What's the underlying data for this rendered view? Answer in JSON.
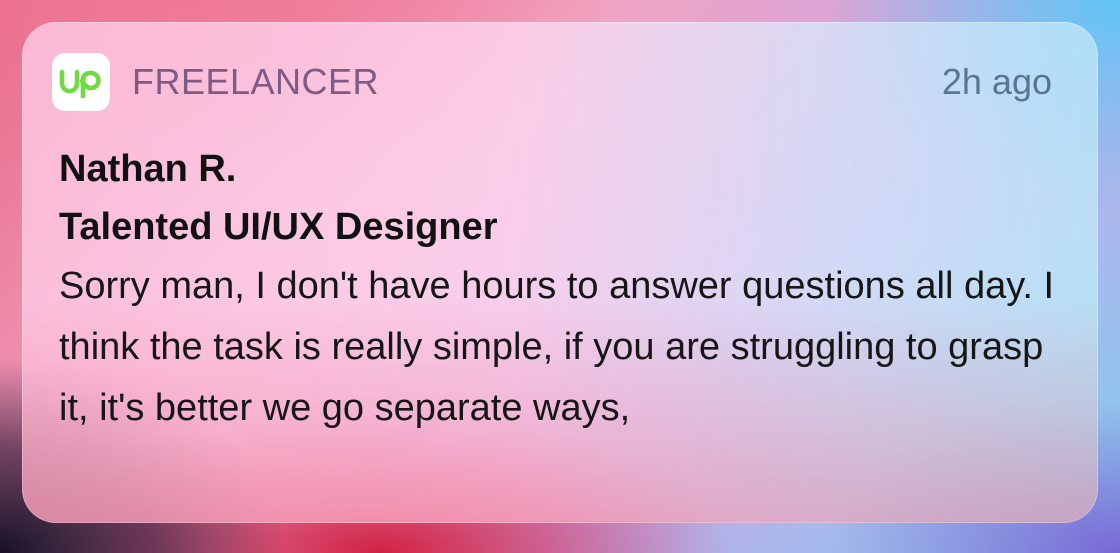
{
  "notification": {
    "app_name": "FREELANCER",
    "app_icon": "upwork-logo",
    "app_icon_text": "Up",
    "timestamp": "2h ago",
    "sender": "Nathan R.",
    "subject": "Talented UI/UX Designer",
    "message": "Sorry man, I don't have hours to answer questions all day. I think the task is really simple, if you are struggling to grasp it, it's better we go separate ways,",
    "colors": {
      "logo_green": "#6fda44",
      "app_name": "#7e5a86",
      "timestamp": "#5a7590"
    }
  }
}
